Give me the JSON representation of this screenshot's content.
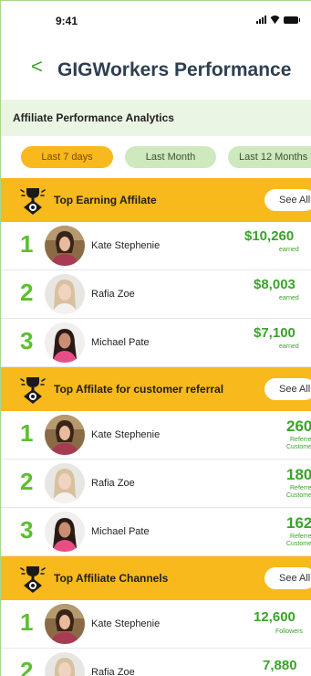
{
  "status": {
    "time": "9:41"
  },
  "nav": {
    "back": "<",
    "title": "GIGWorkers Performance"
  },
  "band": {
    "title": "Affiliate Performance Analytics"
  },
  "filters": [
    "Last 7 days",
    "Last Month",
    "Last 12 Months"
  ],
  "sections": {
    "earning": {
      "title": "Top Earning Affilate",
      "see_all": "See All",
      "rows": [
        {
          "rank": "1",
          "name": "Kate Stephenie",
          "value": "$10,260",
          "sub": "earned"
        },
        {
          "rank": "2",
          "name": "Rafia Zoe",
          "value": "$8,003",
          "sub": "earned"
        },
        {
          "rank": "3",
          "name": "Michael Pate",
          "value": "$7,100",
          "sub": "earned"
        }
      ]
    },
    "referral": {
      "title": "Top Affilate for customer referral",
      "see_all": "See All",
      "rows": [
        {
          "rank": "1",
          "name": "Kate Stephenie",
          "value": "260",
          "sub1": "Referred",
          "sub2": "Customers"
        },
        {
          "rank": "2",
          "name": "Rafia Zoe",
          "value": "180",
          "sub1": "Referred",
          "sub2": "Customers"
        },
        {
          "rank": "3",
          "name": "Michael Pate",
          "value": "162",
          "sub1": "Referred",
          "sub2": "Customers"
        }
      ]
    },
    "channels": {
      "title": "Top Affiliate Channels",
      "see_all": "See All",
      "rows": [
        {
          "rank": "1",
          "name": "Kate Stephenie",
          "value": "12,600",
          "sub": "Followers"
        },
        {
          "rank": "2",
          "name": "Rafia Zoe",
          "value": "7,880",
          "sub": ""
        }
      ]
    }
  },
  "colors": {
    "accent_green": "#3aa32a",
    "rank_green": "#5bbf2f",
    "yellow": "#f8b91d",
    "band": "#eaf5e3",
    "chip_idle": "#cde9bd",
    "title": "#2e3f52"
  },
  "icons": {
    "back": "chevron-left-icon",
    "trophy": "trophy-icon"
  }
}
